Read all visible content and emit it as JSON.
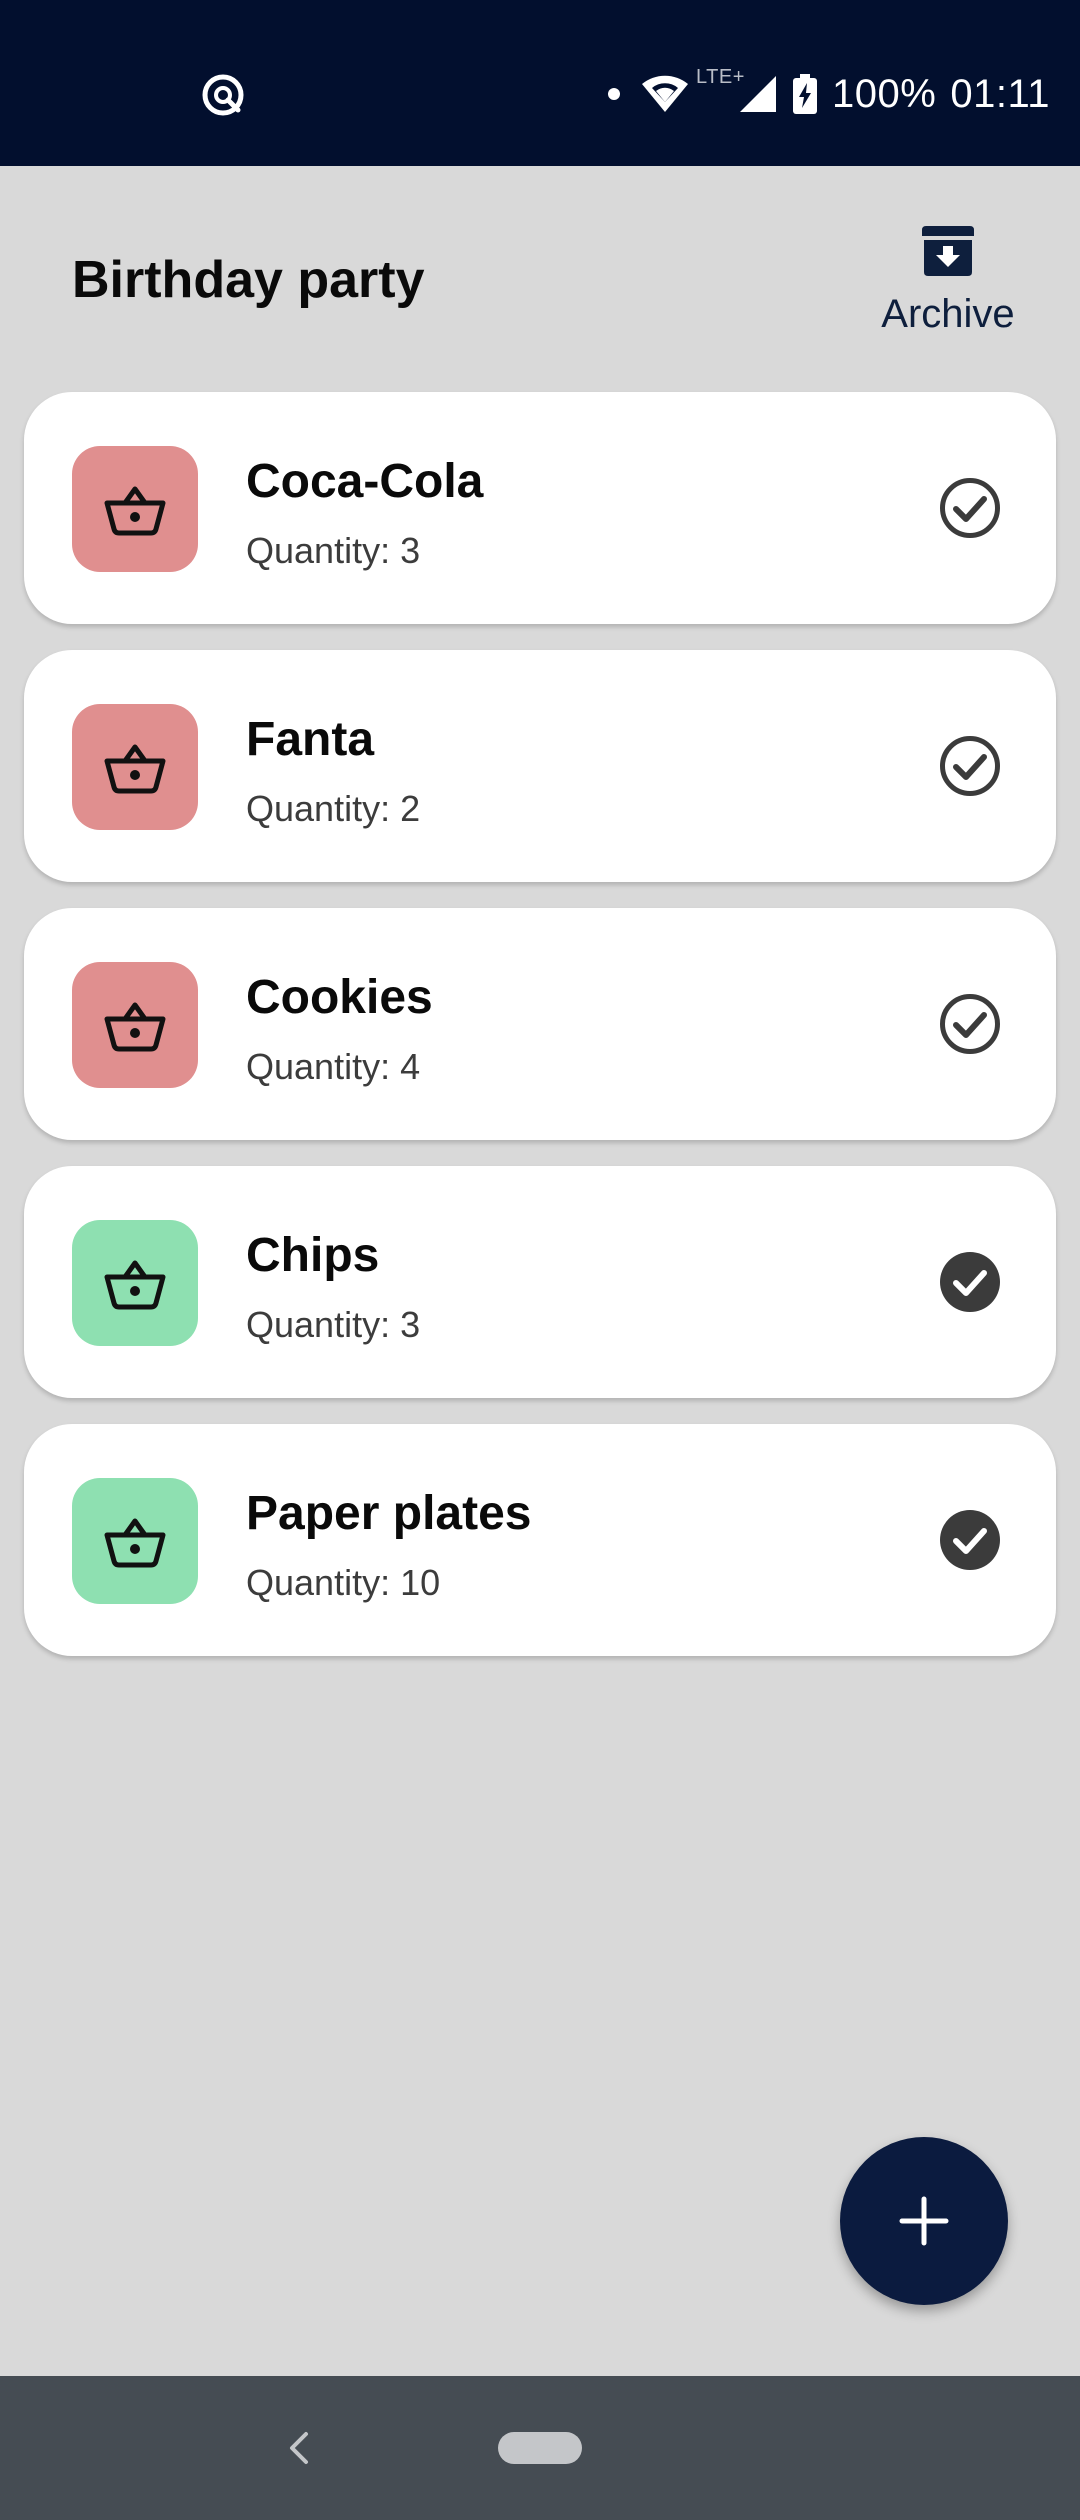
{
  "status_bar": {
    "battery": "100%",
    "time": "01:11",
    "network": "LTE+",
    "icons": [
      "notification-icon",
      "dot-icon",
      "wifi-icon",
      "signal-icon",
      "battery-charging-icon"
    ]
  },
  "header": {
    "title": "Birthday party",
    "archive_label": "Archive"
  },
  "items": [
    {
      "name": "Coca-Cola",
      "quantity_label": "Quantity:",
      "quantity": "3",
      "checked": false,
      "icon_color": "#e08f8f"
    },
    {
      "name": "Fanta",
      "quantity_label": "Quantity:",
      "quantity": "2",
      "checked": false,
      "icon_color": "#e08f8f"
    },
    {
      "name": "Cookies",
      "quantity_label": "Quantity:",
      "quantity": "4",
      "checked": false,
      "icon_color": "#e08f8f"
    },
    {
      "name": "Chips",
      "quantity_label": "Quantity:",
      "quantity": "3",
      "checked": true,
      "icon_color": "#8ee0b1"
    },
    {
      "name": "Paper plates",
      "quantity_label": "Quantity:",
      "quantity": "10",
      "checked": true,
      "icon_color": "#8ee0b1"
    }
  ],
  "colors": {
    "status_bar_bg": "#020f2e",
    "page_bg": "#d9d9d9",
    "fab_bg": "#0b1b3f",
    "unchecked_icon": "#e08f8f",
    "checked_icon": "#8ee0b1",
    "nav_bar_bg": "#454c53"
  },
  "fab": {
    "icon": "plus-icon"
  },
  "nav": {
    "icons": [
      "back-icon",
      "home-pill-icon"
    ]
  }
}
